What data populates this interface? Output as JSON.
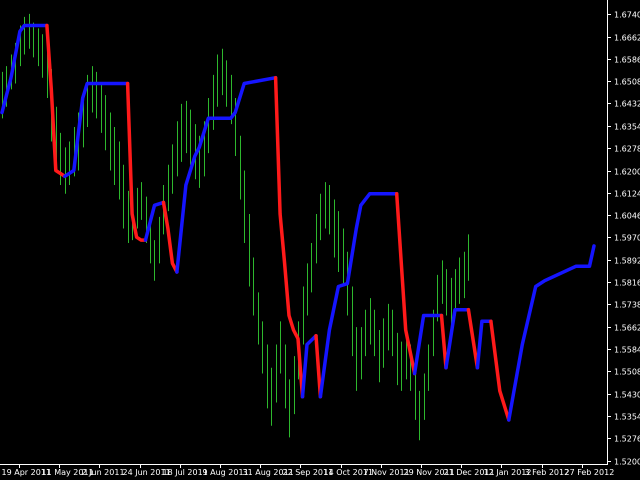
{
  "chart_data": {
    "type": "line",
    "title": "",
    "xlabel": "",
    "ylabel": "",
    "ylim": [
      1.5188,
      1.6788
    ],
    "x_ticks": [
      "19 Apr 2011",
      "11 May 2011",
      "2 Jun 2011",
      "24 Jun 2011",
      "18 Jul 2011",
      "9 Aug 2011",
      "31 Aug 2011",
      "22 Sep 2011",
      "14 Oct 2011",
      "7 Nov 2011",
      "29 Nov 2011",
      "21 Dec 2011",
      "12 Jan 2012",
      "3 Feb 2012",
      "27 Feb 2012"
    ],
    "y_ticks": [
      1.674,
      1.6662,
      1.6586,
      1.6508,
      1.6432,
      1.6354,
      1.6278,
      1.62,
      1.6124,
      1.6046,
      1.597,
      1.5892,
      1.5816,
      1.5738,
      1.5662,
      1.5584,
      1.5508,
      1.543,
      1.5354,
      1.5276,
      1.52
    ],
    "colors": {
      "background": "#000000",
      "bars": "#2db82d",
      "trend_up": "#1515ff",
      "trend_down": "#ff1a1a",
      "axis": "#ffffff"
    },
    "bars": [
      {
        "x": 0,
        "low": 1.638,
        "high": 1.654
      },
      {
        "x": 1,
        "low": 1.642,
        "high": 1.656
      },
      {
        "x": 2,
        "low": 1.648,
        "high": 1.66
      },
      {
        "x": 3,
        "low": 1.65,
        "high": 1.664
      },
      {
        "x": 4,
        "low": 1.656,
        "high": 1.67
      },
      {
        "x": 5,
        "low": 1.66,
        "high": 1.673
      },
      {
        "x": 6,
        "low": 1.662,
        "high": 1.674
      },
      {
        "x": 7,
        "low": 1.659,
        "high": 1.671
      },
      {
        "x": 8,
        "low": 1.656,
        "high": 1.669
      },
      {
        "x": 9,
        "low": 1.652,
        "high": 1.667
      },
      {
        "x": 10,
        "low": 1.645,
        "high": 1.662
      },
      {
        "x": 11,
        "low": 1.63,
        "high": 1.655
      },
      {
        "x": 12,
        "low": 1.62,
        "high": 1.642
      },
      {
        "x": 13,
        "low": 1.615,
        "high": 1.633
      },
      {
        "x": 14,
        "low": 1.612,
        "high": 1.628
      },
      {
        "x": 15,
        "low": 1.615,
        "high": 1.63
      },
      {
        "x": 16,
        "low": 1.618,
        "high": 1.635
      },
      {
        "x": 17,
        "low": 1.62,
        "high": 1.64
      },
      {
        "x": 18,
        "low": 1.628,
        "high": 1.646
      },
      {
        "x": 19,
        "low": 1.635,
        "high": 1.653
      },
      {
        "x": 20,
        "low": 1.64,
        "high": 1.656
      },
      {
        "x": 21,
        "low": 1.638,
        "high": 1.654
      },
      {
        "x": 22,
        "low": 1.633,
        "high": 1.65
      },
      {
        "x": 23,
        "low": 1.627,
        "high": 1.646
      },
      {
        "x": 24,
        "low": 1.62,
        "high": 1.64
      },
      {
        "x": 25,
        "low": 1.615,
        "high": 1.635
      },
      {
        "x": 26,
        "low": 1.61,
        "high": 1.63
      },
      {
        "x": 27,
        "low": 1.6,
        "high": 1.622
      },
      {
        "x": 28,
        "low": 1.595,
        "high": 1.613
      },
      {
        "x": 29,
        "low": 1.596,
        "high": 1.61
      },
      {
        "x": 30,
        "low": 1.6,
        "high": 1.614
      },
      {
        "x": 31,
        "low": 1.603,
        "high": 1.616
      },
      {
        "x": 32,
        "low": 1.595,
        "high": 1.611
      },
      {
        "x": 33,
        "low": 1.588,
        "high": 1.603
      },
      {
        "x": 34,
        "low": 1.582,
        "high": 1.596
      },
      {
        "x": 35,
        "low": 1.588,
        "high": 1.604
      },
      {
        "x": 36,
        "low": 1.598,
        "high": 1.615
      },
      {
        "x": 37,
        "low": 1.606,
        "high": 1.622
      },
      {
        "x": 38,
        "low": 1.612,
        "high": 1.629
      },
      {
        "x": 39,
        "low": 1.618,
        "high": 1.637
      },
      {
        "x": 40,
        "low": 1.623,
        "high": 1.643
      },
      {
        "x": 41,
        "low": 1.626,
        "high": 1.644
      },
      {
        "x": 42,
        "low": 1.622,
        "high": 1.641
      },
      {
        "x": 43,
        "low": 1.617,
        "high": 1.636
      },
      {
        "x": 44,
        "low": 1.614,
        "high": 1.632
      },
      {
        "x": 45,
        "low": 1.618,
        "high": 1.637
      },
      {
        "x": 46,
        "low": 1.626,
        "high": 1.645
      },
      {
        "x": 47,
        "low": 1.634,
        "high": 1.653
      },
      {
        "x": 48,
        "low": 1.642,
        "high": 1.66
      },
      {
        "x": 49,
        "low": 1.646,
        "high": 1.662
      },
      {
        "x": 50,
        "low": 1.642,
        "high": 1.658
      },
      {
        "x": 51,
        "low": 1.636,
        "high": 1.653
      },
      {
        "x": 52,
        "low": 1.625,
        "high": 1.645
      },
      {
        "x": 53,
        "low": 1.61,
        "high": 1.632
      },
      {
        "x": 54,
        "low": 1.595,
        "high": 1.62
      },
      {
        "x": 55,
        "low": 1.58,
        "high": 1.605
      },
      {
        "x": 56,
        "low": 1.57,
        "high": 1.59
      },
      {
        "x": 57,
        "low": 1.56,
        "high": 1.578
      },
      {
        "x": 58,
        "low": 1.55,
        "high": 1.568
      },
      {
        "x": 59,
        "low": 1.538,
        "high": 1.56
      },
      {
        "x": 60,
        "low": 1.532,
        "high": 1.552
      },
      {
        "x": 61,
        "low": 1.54,
        "high": 1.56
      },
      {
        "x": 62,
        "low": 1.55,
        "high": 1.568
      },
      {
        "x": 63,
        "low": 1.538,
        "high": 1.56
      },
      {
        "x": 64,
        "low": 1.528,
        "high": 1.548
      },
      {
        "x": 65,
        "low": 1.536,
        "high": 1.556
      },
      {
        "x": 66,
        "low": 1.548,
        "high": 1.568
      },
      {
        "x": 67,
        "low": 1.56,
        "high": 1.58
      },
      {
        "x": 68,
        "low": 1.57,
        "high": 1.588
      },
      {
        "x": 69,
        "low": 1.578,
        "high": 1.595
      },
      {
        "x": 70,
        "low": 1.588,
        "high": 1.605
      },
      {
        "x": 71,
        "low": 1.596,
        "high": 1.612
      },
      {
        "x": 72,
        "low": 1.6,
        "high": 1.616
      },
      {
        "x": 73,
        "low": 1.598,
        "high": 1.615
      },
      {
        "x": 74,
        "low": 1.59,
        "high": 1.61
      },
      {
        "x": 75,
        "low": 1.585,
        "high": 1.606
      },
      {
        "x": 76,
        "low": 1.58,
        "high": 1.6
      },
      {
        "x": 77,
        "low": 1.57,
        "high": 1.592
      },
      {
        "x": 78,
        "low": 1.556,
        "high": 1.58
      },
      {
        "x": 79,
        "low": 1.544,
        "high": 1.566
      },
      {
        "x": 80,
        "low": 1.548,
        "high": 1.566
      },
      {
        "x": 81,
        "low": 1.556,
        "high": 1.572
      },
      {
        "x": 82,
        "low": 1.56,
        "high": 1.576
      },
      {
        "x": 83,
        "low": 1.556,
        "high": 1.572
      },
      {
        "x": 84,
        "low": 1.547,
        "high": 1.565
      },
      {
        "x": 85,
        "low": 1.552,
        "high": 1.569
      },
      {
        "x": 86,
        "low": 1.558,
        "high": 1.574
      },
      {
        "x": 87,
        "low": 1.556,
        "high": 1.572
      },
      {
        "x": 88,
        "low": 1.546,
        "high": 1.564
      },
      {
        "x": 89,
        "low": 1.544,
        "high": 1.561
      },
      {
        "x": 90,
        "low": 1.548,
        "high": 1.564
      },
      {
        "x": 91,
        "low": 1.544,
        "high": 1.56
      },
      {
        "x": 92,
        "low": 1.534,
        "high": 1.552
      },
      {
        "x": 93,
        "low": 1.527,
        "high": 1.544
      },
      {
        "x": 94,
        "low": 1.534,
        "high": 1.55
      },
      {
        "x": 95,
        "low": 1.544,
        "high": 1.56
      },
      {
        "x": 96,
        "low": 1.556,
        "high": 1.572
      },
      {
        "x": 97,
        "low": 1.568,
        "high": 1.584
      },
      {
        "x": 98,
        "low": 1.574,
        "high": 1.589
      },
      {
        "x": 99,
        "low": 1.57,
        "high": 1.586
      },
      {
        "x": 100,
        "low": 1.566,
        "high": 1.583
      },
      {
        "x": 101,
        "low": 1.57,
        "high": 1.586
      },
      {
        "x": 102,
        "low": 1.574,
        "high": 1.59
      },
      {
        "x": 103,
        "low": 1.576,
        "high": 1.592
      },
      {
        "x": 104,
        "low": 1.582,
        "high": 1.598
      }
    ],
    "trend_segments": [
      {
        "color": "up",
        "points": [
          [
            0,
            1.64
          ],
          [
            2,
            1.652
          ],
          [
            4,
            1.668
          ],
          [
            5,
            1.67
          ],
          [
            10,
            1.67
          ]
        ]
      },
      {
        "color": "down",
        "points": [
          [
            10,
            1.67
          ],
          [
            11,
            1.648
          ],
          [
            12,
            1.62
          ],
          [
            13,
            1.619
          ],
          [
            14,
            1.618
          ]
        ]
      },
      {
        "color": "up",
        "points": [
          [
            14,
            1.618
          ],
          [
            16,
            1.62
          ],
          [
            18,
            1.645
          ],
          [
            19,
            1.65
          ],
          [
            28,
            1.65
          ]
        ]
      },
      {
        "color": "down",
        "points": [
          [
            28,
            1.65
          ],
          [
            29,
            1.605
          ],
          [
            30,
            1.597
          ],
          [
            31,
            1.596
          ],
          [
            32,
            1.596
          ]
        ]
      },
      {
        "color": "up",
        "points": [
          [
            32,
            1.596
          ],
          [
            34,
            1.608
          ],
          [
            36,
            1.609
          ]
        ]
      },
      {
        "color": "down",
        "points": [
          [
            36,
            1.609
          ],
          [
            37,
            1.6
          ],
          [
            38,
            1.588
          ],
          [
            39,
            1.585
          ]
        ]
      },
      {
        "color": "up",
        "points": [
          [
            39,
            1.585
          ],
          [
            41,
            1.615
          ],
          [
            43,
            1.625
          ],
          [
            44,
            1.628
          ],
          [
            46,
            1.638
          ],
          [
            51,
            1.638
          ],
          [
            52,
            1.64
          ],
          [
            54,
            1.65
          ],
          [
            61,
            1.652
          ]
        ]
      },
      {
        "color": "down",
        "points": [
          [
            61,
            1.652
          ],
          [
            62,
            1.605
          ],
          [
            63,
            1.588
          ],
          [
            64,
            1.57
          ],
          [
            65,
            1.565
          ],
          [
            66,
            1.562
          ],
          [
            67,
            1.542
          ]
        ]
      },
      {
        "color": "up",
        "points": [
          [
            67,
            1.542
          ],
          [
            68,
            1.56
          ],
          [
            70,
            1.563
          ]
        ]
      },
      {
        "color": "down",
        "points": [
          [
            70,
            1.563
          ],
          [
            71,
            1.542
          ]
        ]
      },
      {
        "color": "up",
        "points": [
          [
            71,
            1.542
          ],
          [
            73,
            1.565
          ],
          [
            75,
            1.58
          ],
          [
            77,
            1.581
          ],
          [
            79,
            1.6
          ],
          [
            80,
            1.608
          ],
          [
            82,
            1.612
          ],
          [
            88,
            1.612
          ]
        ]
      },
      {
        "color": "down",
        "points": [
          [
            88,
            1.612
          ],
          [
            90,
            1.565
          ],
          [
            92,
            1.55
          ]
        ]
      },
      {
        "color": "up",
        "points": [
          [
            92,
            1.55
          ],
          [
            94,
            1.57
          ],
          [
            98,
            1.57
          ]
        ]
      },
      {
        "color": "down",
        "points": [
          [
            98,
            1.57
          ],
          [
            99,
            1.552
          ]
        ]
      },
      {
        "color": "up",
        "points": [
          [
            99,
            1.552
          ],
          [
            101,
            1.572
          ],
          [
            104,
            1.572
          ]
        ]
      },
      {
        "color": "down",
        "points": [
          [
            104,
            1.572
          ],
          [
            106,
            1.552
          ]
        ]
      },
      {
        "color": "up",
        "points": [
          [
            106,
            1.552
          ],
          [
            107,
            1.568
          ],
          [
            109,
            1.568
          ]
        ]
      },
      {
        "color": "down",
        "points": [
          [
            109,
            1.568
          ],
          [
            111,
            1.544
          ],
          [
            113,
            1.534
          ]
        ]
      },
      {
        "color": "up",
        "points": [
          [
            113,
            1.534
          ],
          [
            116,
            1.56
          ],
          [
            119,
            1.58
          ],
          [
            121,
            1.582
          ],
          [
            128,
            1.587
          ],
          [
            131,
            1.587
          ],
          [
            132,
            1.594
          ]
        ]
      }
    ]
  }
}
